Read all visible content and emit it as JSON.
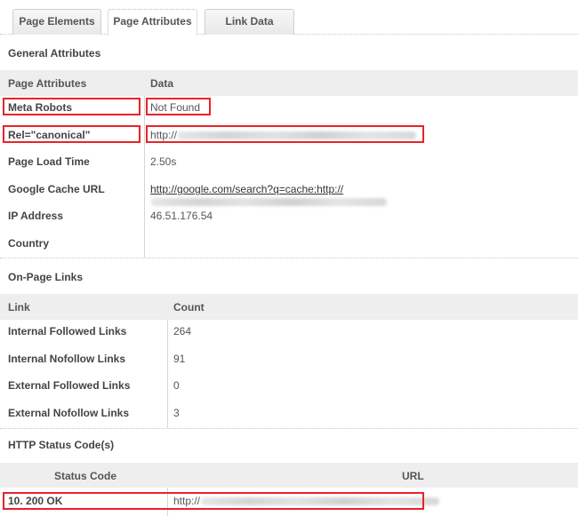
{
  "tabs": [
    {
      "label": "Page Elements",
      "active": false
    },
    {
      "label": "Page Attributes",
      "active": true
    },
    {
      "label": "Link Data",
      "active": false
    }
  ],
  "general": {
    "title": "General Attributes",
    "headers": [
      "Page Attributes",
      "Data"
    ],
    "rows": [
      {
        "label": "Meta Robots",
        "value": "Not Found"
      },
      {
        "label": "Rel=\"canonical\"",
        "value": "http://"
      },
      {
        "label": "Page Load Time",
        "value": "2.50s"
      },
      {
        "label": "Google Cache URL",
        "value": "http://google.com/search?q=cache:http://"
      },
      {
        "label": "IP Address",
        "value": "46.51.176.54"
      },
      {
        "label": "Country",
        "value": ""
      }
    ]
  },
  "links": {
    "title": "On-Page Links",
    "headers": [
      "Link",
      "Count"
    ],
    "rows": [
      {
        "label": "Internal Followed Links",
        "value": "264"
      },
      {
        "label": "Internal Nofollow Links",
        "value": "91"
      },
      {
        "label": "External Followed Links",
        "value": "0"
      },
      {
        "label": "External Nofollow Links",
        "value": "3"
      }
    ]
  },
  "status": {
    "title": "HTTP Status Code(s)",
    "headers": [
      "Status Code",
      "URL"
    ],
    "rows": [
      {
        "code": "10. 200 OK",
        "url": "http://"
      }
    ]
  },
  "highlight_color": "#e8222a"
}
